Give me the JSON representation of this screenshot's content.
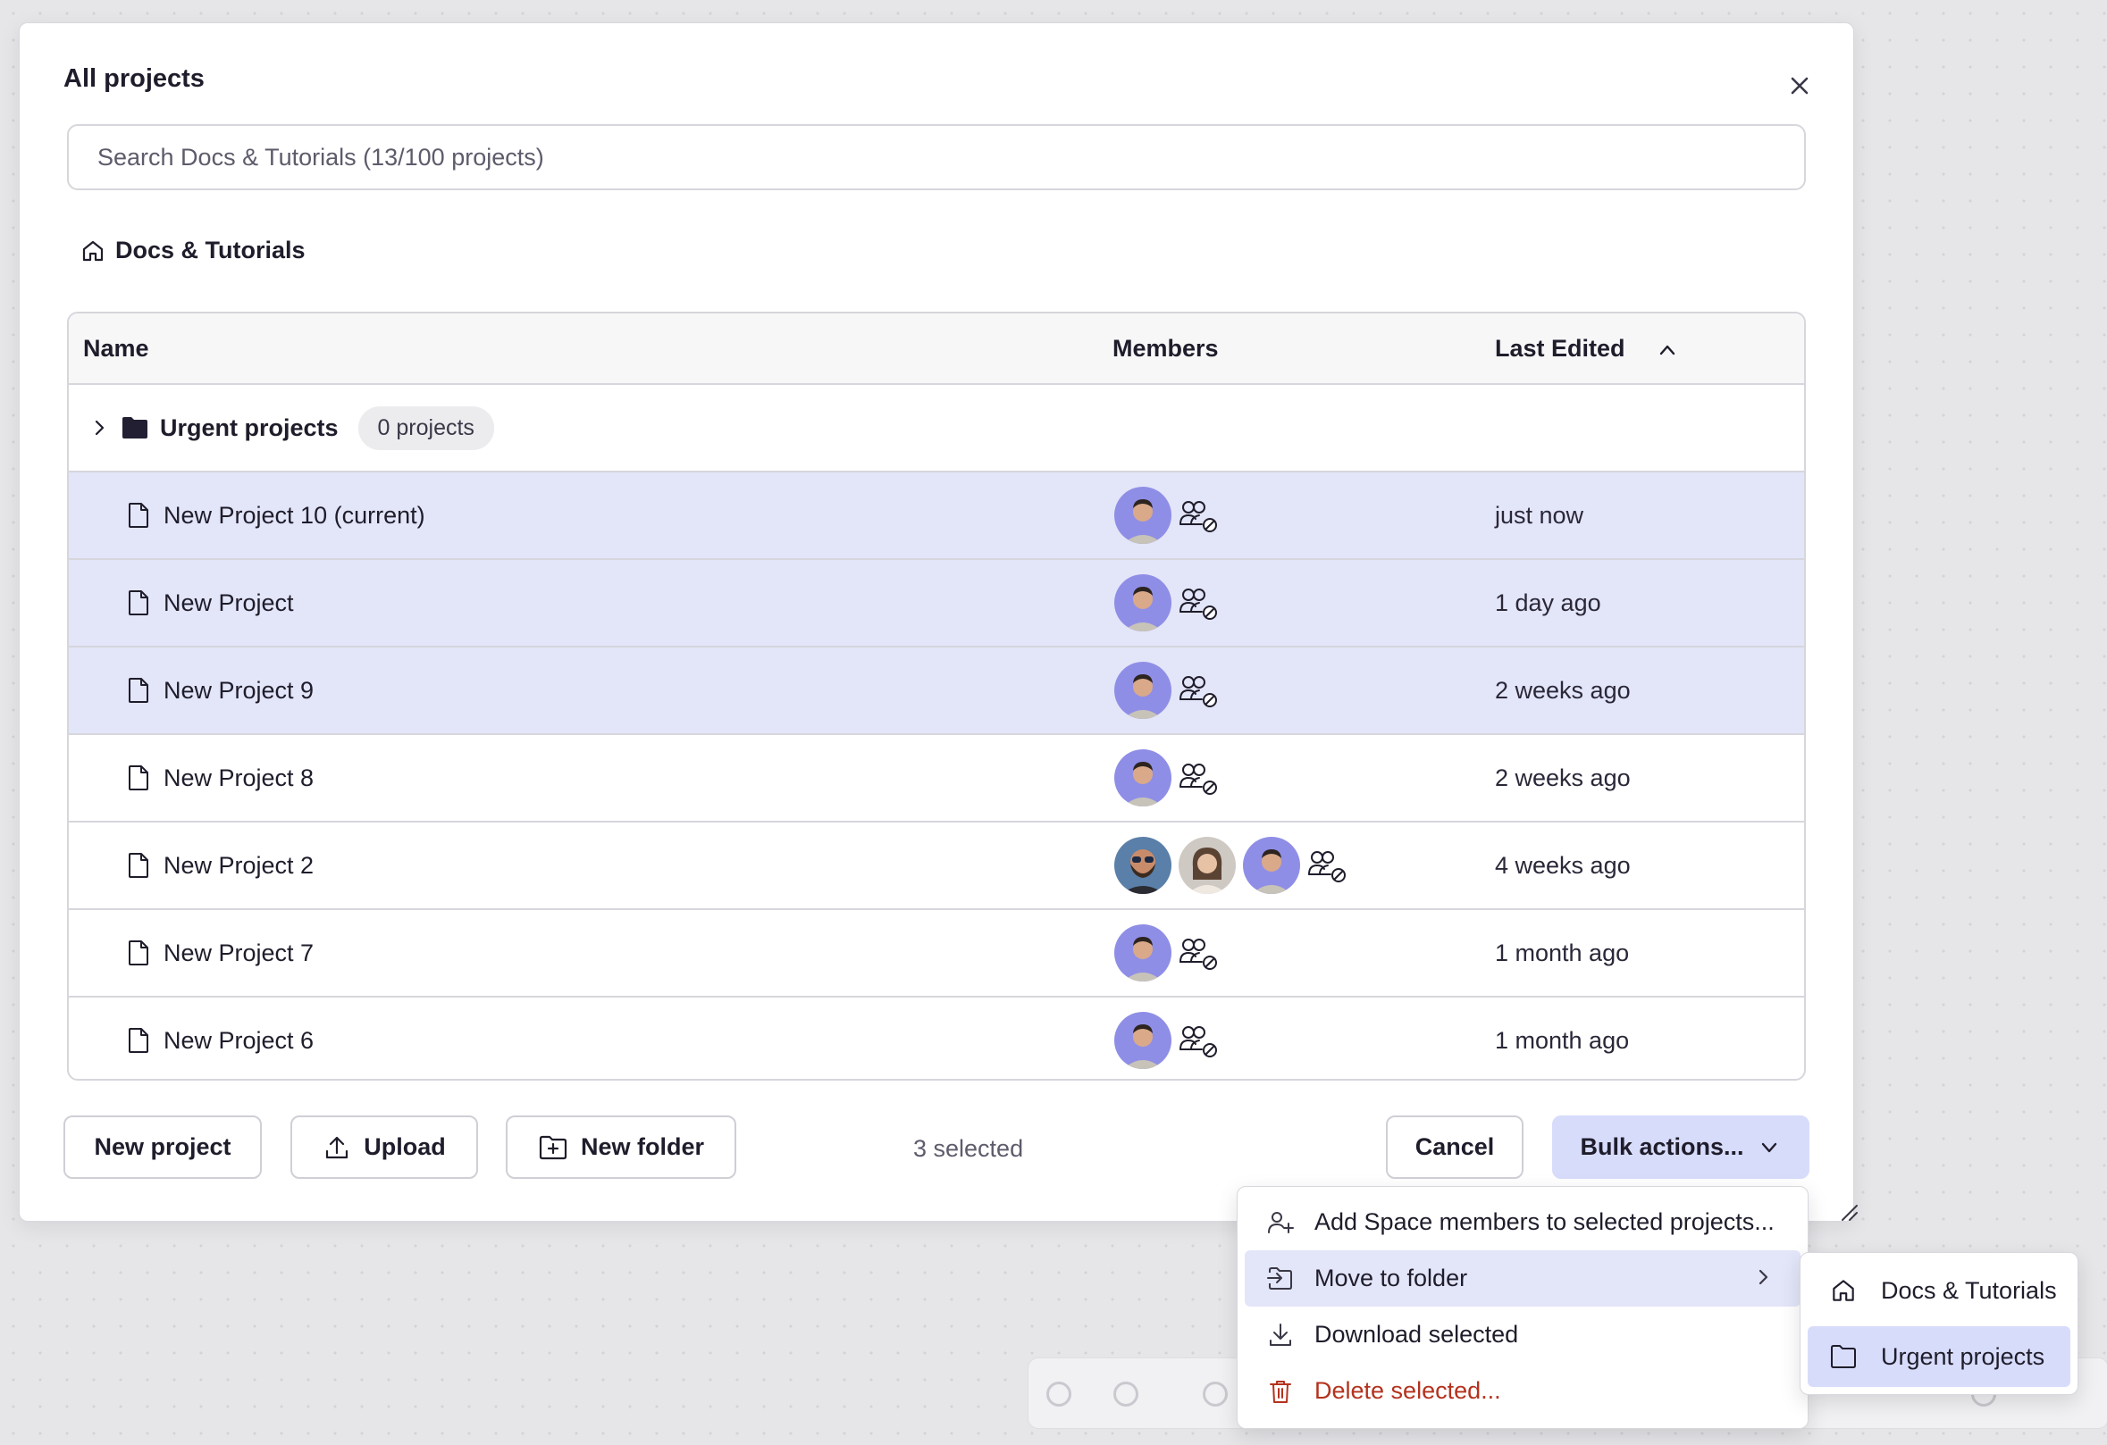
{
  "dialog": {
    "title": "All projects",
    "search_placeholder": "Search Docs & Tutorials (13/100 projects)",
    "breadcrumb": "Docs & Tutorials"
  },
  "table": {
    "columns": {
      "name": "Name",
      "members": "Members",
      "last_edited": "Last Edited"
    },
    "folder": {
      "name": "Urgent projects",
      "badge": "0 projects"
    },
    "rows": [
      {
        "name": "New Project 10 (current)",
        "edited": "just now",
        "selected": true,
        "avatars": [
          "man-avatar"
        ]
      },
      {
        "name": "New Project",
        "edited": "1 day ago",
        "selected": true,
        "avatars": [
          "man-avatar"
        ]
      },
      {
        "name": "New Project 9",
        "edited": "2 weeks ago",
        "selected": true,
        "avatars": [
          "man-avatar"
        ]
      },
      {
        "name": "New Project 8",
        "edited": "2 weeks ago",
        "selected": false,
        "avatars": [
          "man-avatar"
        ]
      },
      {
        "name": "New Project 2",
        "edited": "4 weeks ago",
        "selected": false,
        "avatars": [
          "bearded-man-avatar",
          "woman-avatar",
          "man-avatar"
        ]
      },
      {
        "name": "New Project 7",
        "edited": "1 month ago",
        "selected": false,
        "avatars": [
          "man-avatar"
        ]
      },
      {
        "name": "New Project 6",
        "edited": "1 month ago",
        "selected": false,
        "avatars": [
          "man-avatar"
        ]
      }
    ]
  },
  "footer": {
    "new_project": "New project",
    "upload": "Upload",
    "new_folder": "New folder",
    "selected_count": "3 selected",
    "cancel": "Cancel",
    "bulk_actions": "Bulk actions..."
  },
  "bulk_menu": {
    "items": [
      "Add Space members to selected projects...",
      "Move to folder",
      "Download selected",
      "Delete selected..."
    ]
  },
  "folder_submenu": {
    "items": [
      "Docs & Tutorials",
      "Urgent projects"
    ]
  },
  "colors": {
    "selected_row": "#e3e5f9",
    "primary_button": "#d8dcfb",
    "danger": "#b4321d",
    "avatar_bg": "#8f8ee6"
  }
}
